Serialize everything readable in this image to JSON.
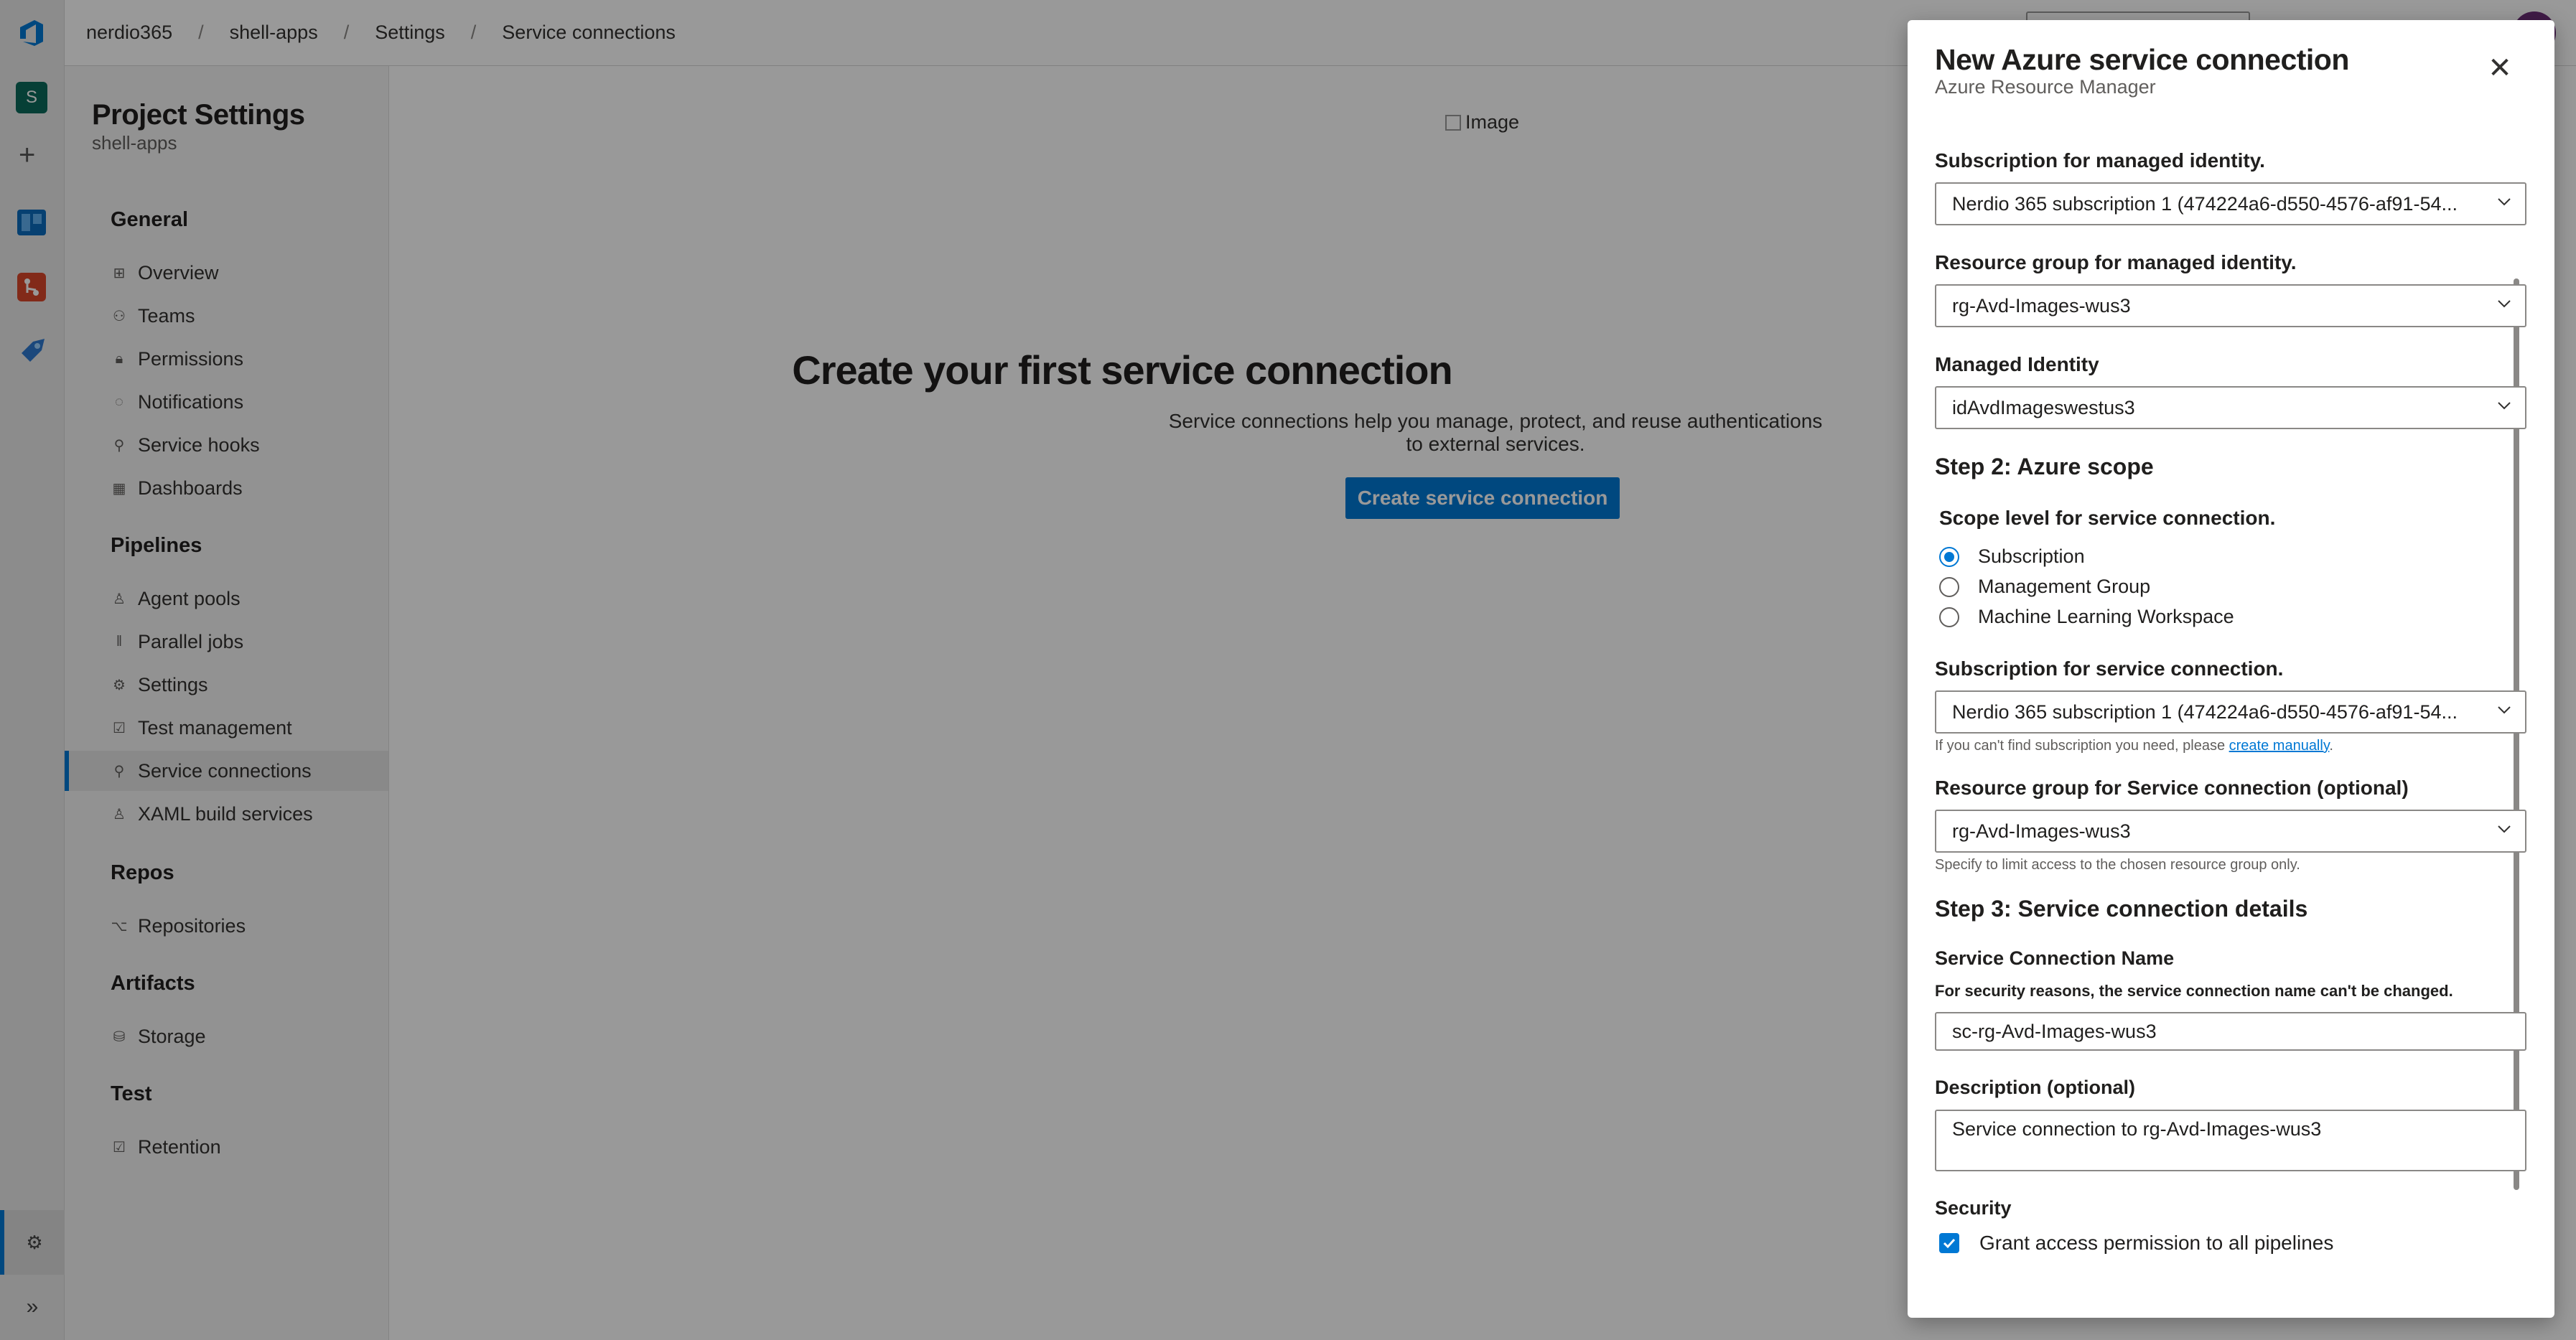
{
  "breadcrumb": {
    "org": "nerdio365",
    "project": "shell-apps",
    "settings": "Settings",
    "current": "Service connections",
    "separator": "/"
  },
  "rail": {
    "project_initial": "S",
    "icons": [
      "azure-devops-logo-icon",
      "plus-icon",
      "boards-icon",
      "repos-icon",
      "pipelines-icon",
      "gear-icon",
      "chevron-double-right-icon"
    ]
  },
  "settings_nav": {
    "title": "Project Settings",
    "subtitle": "shell-apps",
    "groups": {
      "general": "General",
      "pipelines": "Pipelines",
      "repos": "Repos",
      "artifacts": "Artifacts",
      "test": "Test"
    },
    "general_items": [
      "Overview",
      "Teams",
      "Permissions",
      "Notifications",
      "Service hooks",
      "Dashboards"
    ],
    "pipelines_items": [
      "Agent pools",
      "Parallel jobs",
      "Settings",
      "Test management",
      "Service connections",
      "XAML build services"
    ],
    "repos_items": [
      "Repositories"
    ],
    "artifacts_items": [
      "Storage"
    ],
    "test_items": [
      "Retention"
    ],
    "active_item": "Service connections"
  },
  "main": {
    "image_alt": "Image",
    "empty_title": "Create your first service connection",
    "empty_desc": "Service connections help you manage, protect, and reuse authentications to external services.",
    "cta_label": "Create service connection"
  },
  "panel": {
    "title": "New Azure service connection",
    "subtitle": "Azure Resource Manager",
    "mi_subscription_label": "Subscription for managed identity.",
    "mi_subscription_value": "Nerdio 365 subscription 1 (474224a6-d550-4576-af91-54...",
    "mi_rg_label": "Resource group for managed identity.",
    "mi_rg_value": "rg-Avd-Images-wus3",
    "mi_label": "Managed Identity",
    "mi_value": "idAvdImageswestus3",
    "step2_title": "Step 2: Azure scope",
    "scope_label": "Scope level for service connection.",
    "scope_options": [
      "Subscription",
      "Management Group",
      "Machine Learning Workspace"
    ],
    "scope_selected": "Subscription",
    "sc_subscription_label": "Subscription for service connection.",
    "sc_subscription_value": "Nerdio 365 subscription 1 (474224a6-d550-4576-af91-54...",
    "sc_subscription_hint_prefix": "If you can't find subscription you need, please ",
    "sc_subscription_hint_link": "create manually",
    "sc_subscription_hint_suffix": ".",
    "sc_rg_label": "Resource group for Service connection (optional)",
    "sc_rg_value": "rg-Avd-Images-wus3",
    "sc_rg_hint": "Specify to limit access to the chosen resource group only.",
    "step3_title": "Step 3: Service connection details",
    "name_label": "Service Connection Name",
    "name_note": "For security reasons, the service connection name can't be changed.",
    "name_value": "sc-rg-Avd-Images-wus3",
    "desc_label": "Description (optional)",
    "desc_value": "Service connection to rg-Avd-Images-wus3",
    "security_label": "Security",
    "grant_label": "Grant access permission to all pipelines",
    "grant_checked": true
  },
  "colors": {
    "accent": "#0078d4",
    "project_badge": "#0b6a5b",
    "overlay": "rgba(0,0,0,0.40)"
  }
}
